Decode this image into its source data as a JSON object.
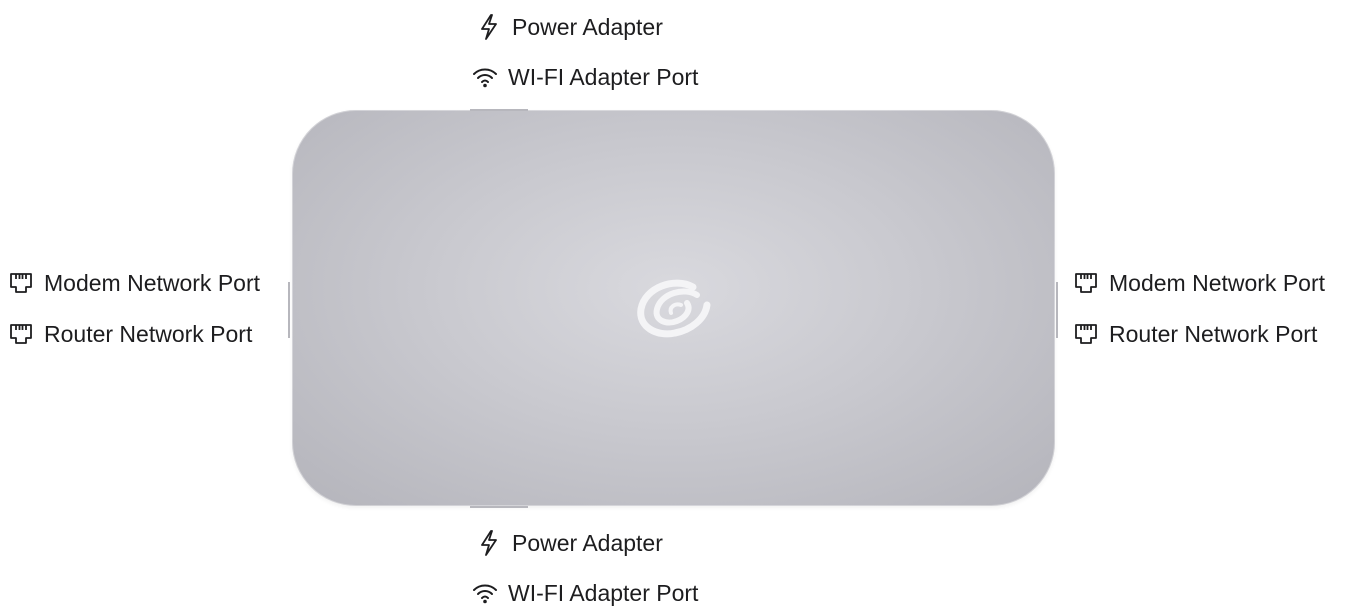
{
  "labels": {
    "top_power": "Power Adapter",
    "top_wifi": "WI-FI Adapter Port",
    "left_modem": "Modem Network Port",
    "left_router": "Router Network Port",
    "right_modem": "Modem Network Port",
    "right_router": "Router Network Port",
    "bottom_power": "Power Adapter",
    "bottom_wifi": "WI-FI Adapter Port"
  },
  "icons": {
    "power": "lightning-bolt-icon",
    "wifi": "wifi-icon",
    "ethernet": "ethernet-port-icon",
    "logo": "swirl-logo"
  },
  "colors": {
    "device_light": "#d9d9de",
    "device_dark": "#b4b4bb",
    "text": "#1d1d1f"
  }
}
